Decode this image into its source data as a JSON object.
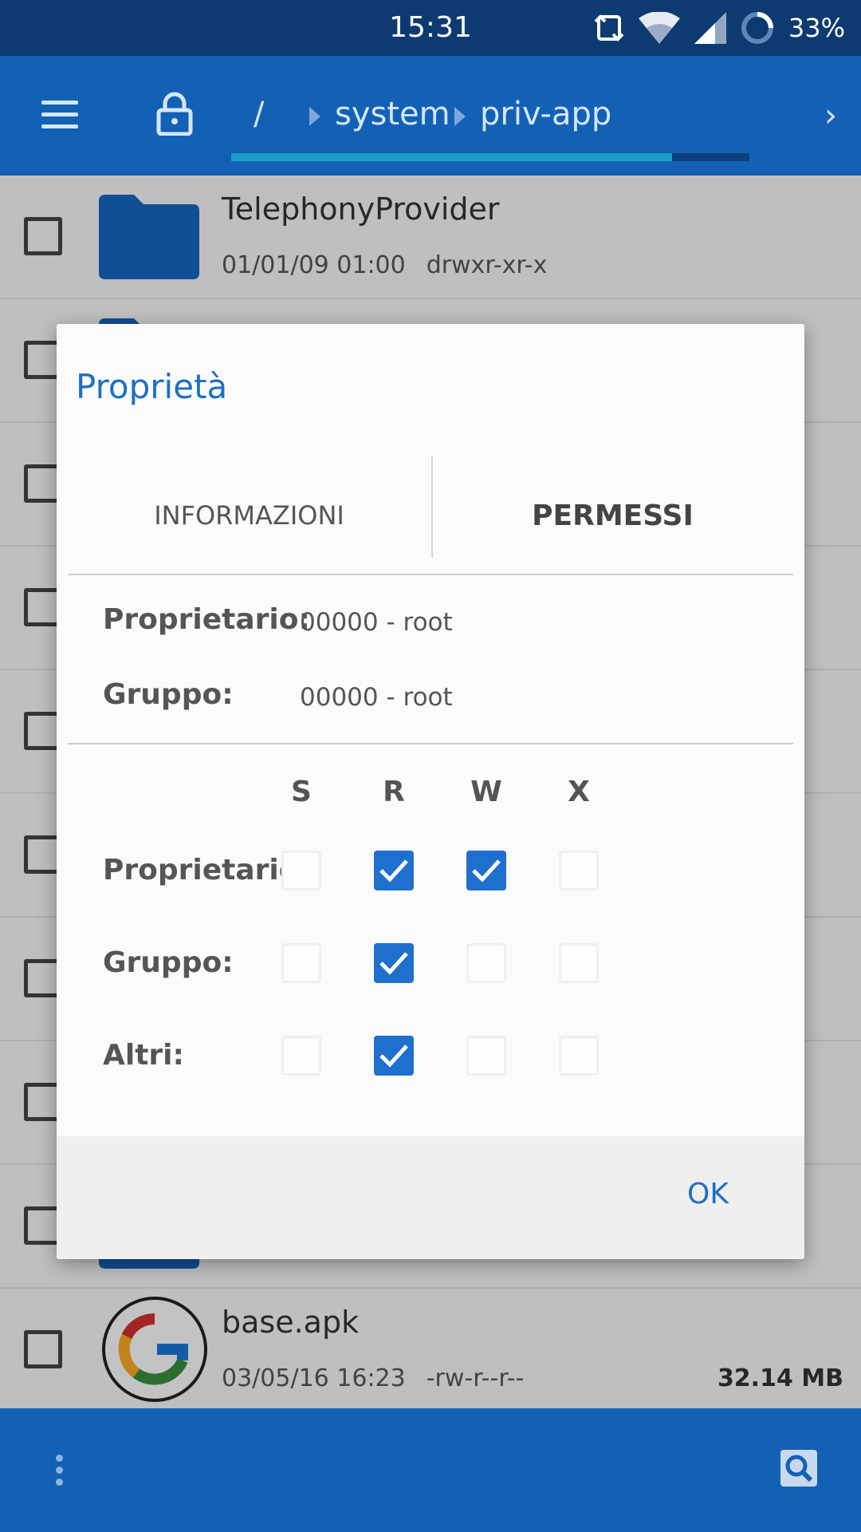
{
  "status_bar": {
    "time": "15:31",
    "battery": "33%"
  },
  "toolbar": {
    "breadcrumb": [
      "/",
      "system",
      "priv-app"
    ],
    "progress": 0.85
  },
  "files": [
    {
      "name": "TelephonyProvider",
      "date": "01/01/09 01:00",
      "perm": "drwxr-xr-x",
      "size": ""
    },
    {
      "name": "base.apk",
      "date": "03/05/16 16:23",
      "perm": "-rw-r--r--",
      "size": "32.14 MB"
    }
  ],
  "dialog": {
    "title": "Proprietà",
    "tabs": [
      {
        "label": "INFORMAZIONI",
        "active": false
      },
      {
        "label": "PERMESSI",
        "active": true
      }
    ],
    "owner": {
      "label": "Proprietario:",
      "value": "00000 - root"
    },
    "group": {
      "label": "Gruppo:",
      "value": "00000 - root"
    },
    "columns": [
      "S",
      "R",
      "W",
      "X"
    ],
    "permissions": [
      {
        "label": "Proprietario:",
        "checks": [
          false,
          true,
          true,
          false
        ]
      },
      {
        "label": "Gruppo:",
        "checks": [
          false,
          true,
          false,
          false
        ]
      },
      {
        "label": "Altri:",
        "checks": [
          false,
          true,
          false,
          false
        ]
      }
    ],
    "ok_label": "OK"
  },
  "colors": {
    "primary": "#1361b5",
    "accent": "#1e6fc4",
    "checkbox": "#1f6fcf"
  }
}
